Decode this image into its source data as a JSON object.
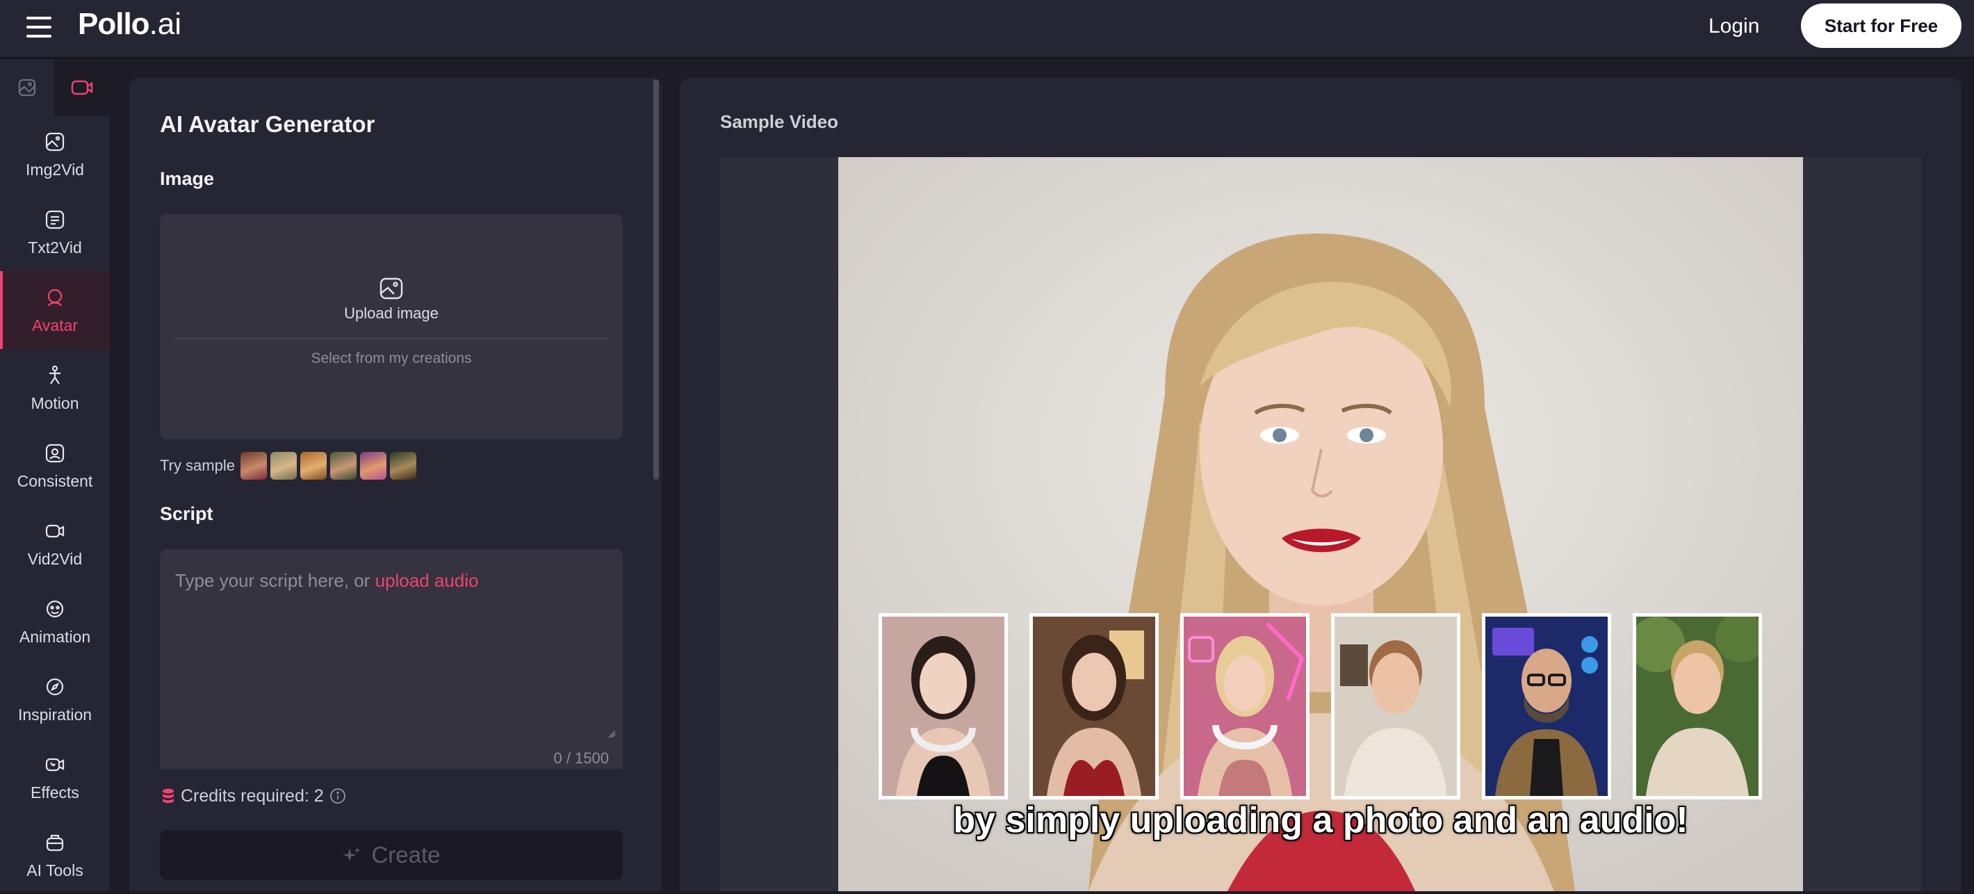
{
  "header": {
    "menu_icon": "hamburger-icon",
    "logo_main": "Pollo",
    "logo_suffix": ".ai",
    "login_label": "Login",
    "cta_label": "Start for Free"
  },
  "sidebar": {
    "mode_toggle": [
      {
        "icon": "image-mode-icon",
        "active": false
      },
      {
        "icon": "video-mode-icon",
        "active": true
      }
    ],
    "items": [
      {
        "label": "Img2Vid",
        "icon": "img2vid-icon",
        "active": false
      },
      {
        "label": "Txt2Vid",
        "icon": "txt2vid-icon",
        "active": false
      },
      {
        "label": "Avatar",
        "icon": "avatar-icon",
        "active": true
      },
      {
        "label": "Motion",
        "icon": "motion-icon",
        "active": false
      },
      {
        "label": "Consistent",
        "icon": "consistent-icon",
        "active": false
      },
      {
        "label": "Vid2Vid",
        "icon": "vid2vid-icon",
        "active": false
      },
      {
        "label": "Animation",
        "icon": "animation-icon",
        "active": false
      },
      {
        "label": "Inspiration",
        "icon": "compass-icon",
        "active": false
      },
      {
        "label": "Effects",
        "icon": "effects-icon",
        "active": false
      },
      {
        "label": "AI Tools",
        "icon": "toolbox-icon",
        "active": false
      }
    ]
  },
  "form": {
    "title": "AI Avatar Generator",
    "image_section": "Image",
    "upload_label": "Upload image",
    "select_creations": "Select from my creations",
    "try_sample_label": "Try sample",
    "script_section": "Script",
    "script_placeholder": "Type your script here, or",
    "upload_audio_label": "upload audio",
    "char_count": "0 / 1500",
    "credits_label": "Credits required: 2",
    "create_label": "Create"
  },
  "preview": {
    "title": "Sample Video",
    "caption": "by simply uploading a photo and an audio!"
  },
  "colors": {
    "accent": "#f0436d",
    "bg": "#1c1b26",
    "panel": "#262533",
    "field": "#34333f"
  }
}
